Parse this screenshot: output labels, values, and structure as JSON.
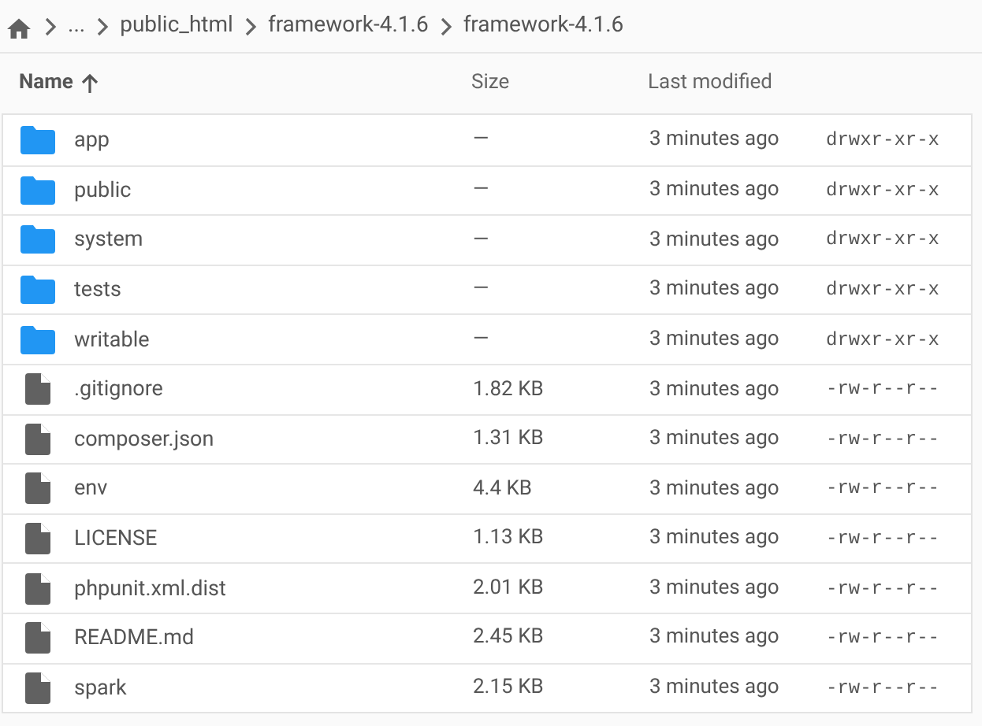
{
  "breadcrumb": [
    "...",
    "public_html",
    "framework-4.1.6",
    "framework-4.1.6"
  ],
  "table": {
    "columns": [
      {
        "label": "Name",
        "sorted": true
      },
      {
        "label": "Size"
      },
      {
        "label": "Last modified"
      }
    ],
    "rows": [
      {
        "kind": "folder",
        "name": "app",
        "size": "—",
        "modified": "3 minutes ago",
        "permissions": "drwxr-xr-x"
      },
      {
        "kind": "folder",
        "name": "public",
        "size": "—",
        "modified": "3 minutes ago",
        "permissions": "drwxr-xr-x"
      },
      {
        "kind": "folder",
        "name": "system",
        "size": "—",
        "modified": "3 minutes ago",
        "permissions": "drwxr-xr-x"
      },
      {
        "kind": "folder",
        "name": "tests",
        "size": "—",
        "modified": "3 minutes ago",
        "permissions": "drwxr-xr-x"
      },
      {
        "kind": "folder",
        "name": "writable",
        "size": "—",
        "modified": "3 minutes ago",
        "permissions": "drwxr-xr-x"
      },
      {
        "kind": "file",
        "name": ".gitignore",
        "size": "1.82 KB",
        "modified": "3 minutes ago",
        "permissions": "-rw-r--r--"
      },
      {
        "kind": "file",
        "name": "composer.json",
        "size": "1.31 KB",
        "modified": "3 minutes ago",
        "permissions": "-rw-r--r--"
      },
      {
        "kind": "file",
        "name": "env",
        "size": "4.4 KB",
        "modified": "3 minutes ago",
        "permissions": "-rw-r--r--"
      },
      {
        "kind": "file",
        "name": "LICENSE",
        "size": "1.13 KB",
        "modified": "3 minutes ago",
        "permissions": "-rw-r--r--"
      },
      {
        "kind": "file",
        "name": "phpunit.xml.dist",
        "size": "2.01 KB",
        "modified": "3 minutes ago",
        "permissions": "-rw-r--r--"
      },
      {
        "kind": "file",
        "name": "README.md",
        "size": "2.45 KB",
        "modified": "3 minutes ago",
        "permissions": "-rw-r--r--"
      },
      {
        "kind": "file",
        "name": "spark",
        "size": "2.15 KB",
        "modified": "3 minutes ago",
        "permissions": "-rw-r--r--"
      }
    ]
  }
}
